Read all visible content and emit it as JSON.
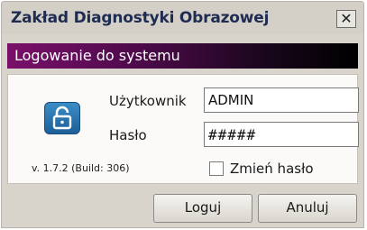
{
  "window": {
    "title": "Zakład Diagnostyki Obrazowej",
    "close_symbol": "✕"
  },
  "header": {
    "text": "Logowanie do systemu"
  },
  "form": {
    "user_label": "Użytkownik",
    "user_value": "ADMIN",
    "password_label": "Hasło",
    "password_value": "#####",
    "change_password_label": "Zmień hasło",
    "change_password_checked": false
  },
  "version": "v. 1.7.2 (Build: 306)",
  "buttons": {
    "login": "Loguj",
    "cancel": "Anuluj"
  },
  "icons": {
    "lock": "lock-icon",
    "close": "close-icon"
  },
  "colors": {
    "title_text": "#1f2c52",
    "header_gradient_start": "#7a0f6a",
    "header_gradient_end": "#000000",
    "lock_blue": "#2a77b4"
  }
}
